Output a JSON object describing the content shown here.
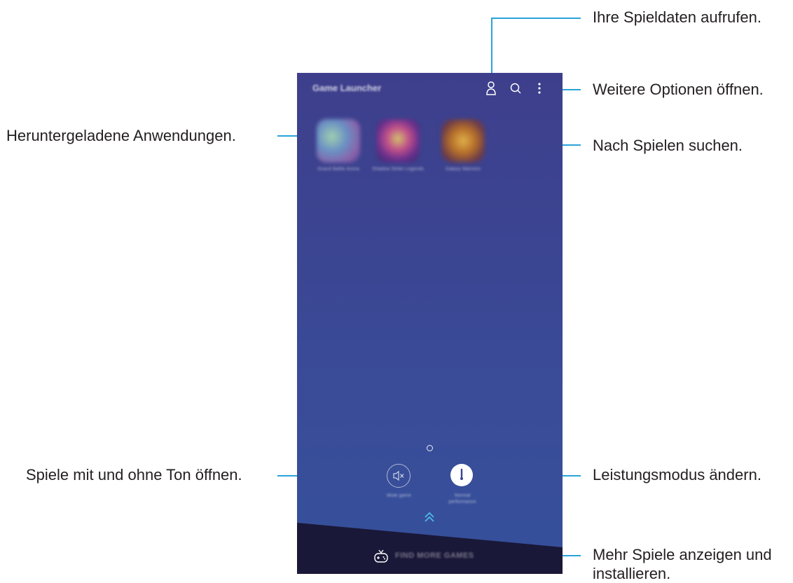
{
  "phone": {
    "title": "Game Launcher",
    "games": [
      {
        "label": "Grand Battle Arena"
      },
      {
        "label": "Shadow Strike Legends"
      },
      {
        "label": "Galaxy Warriors"
      }
    ],
    "mute_label": "Mute game",
    "performance_label": "Normal performance",
    "find_more_label": "FIND MORE GAMES",
    "icons": [
      "profile-icon",
      "search-icon",
      "more-options-icon",
      "mute-icon",
      "performance-icon",
      "expand-up-icon",
      "gamepad-icon"
    ]
  },
  "callouts": {
    "game_data": "Ihre Spieldaten aufrufen.",
    "more_options": "Weitere Optionen öffnen.",
    "downloaded_apps": "Heruntergeladene Anwendungen.",
    "search_games": "Nach Spielen suchen.",
    "mute_games": "Spiele mit und ohne Ton öffnen.",
    "performance_mode": "Leistungsmodus ändern.",
    "more_games_line1": "Mehr Spiele anzeigen und",
    "more_games_line2": "installieren."
  },
  "colors": {
    "accent_line": "#29a3d9",
    "screen_background": "#3b4592",
    "bottom_bar": "#1a1838"
  }
}
